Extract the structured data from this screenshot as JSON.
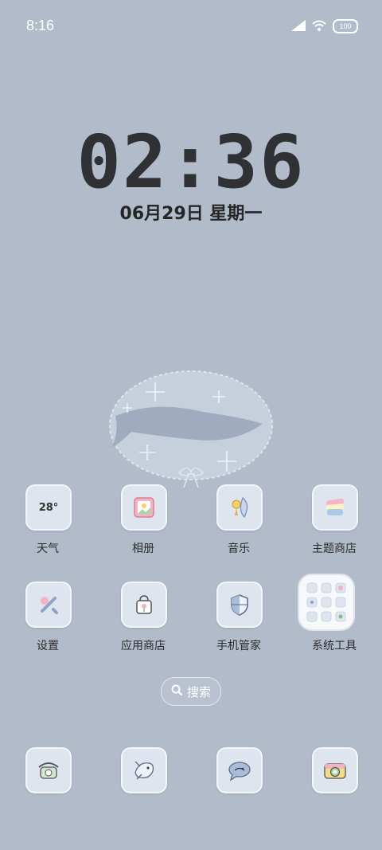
{
  "status_bar": {
    "time": "8:16",
    "battery": "100",
    "icons": [
      "signal-icon",
      "wifi-icon",
      "battery-icon"
    ]
  },
  "lock_widget": {
    "clock": "02:36",
    "date": "06月29日 星期一"
  },
  "apps_row1": [
    {
      "label": "天气",
      "icon": "weather-icon",
      "badge_text": "28°"
    },
    {
      "label": "相册",
      "icon": "gallery-icon"
    },
    {
      "label": "音乐",
      "icon": "music-icon"
    },
    {
      "label": "主题商店",
      "icon": "theme-store-icon"
    }
  ],
  "apps_row2": [
    {
      "label": "设置",
      "icon": "settings-icon"
    },
    {
      "label": "应用商店",
      "icon": "app-store-icon"
    },
    {
      "label": "手机管家",
      "icon": "security-icon"
    },
    {
      "label": "系统工具",
      "icon": "system-tools-folder-icon"
    }
  ],
  "search": {
    "label": "搜索",
    "icon": "search-icon"
  },
  "dock": [
    {
      "icon": "phone-icon"
    },
    {
      "icon": "messages-icon"
    },
    {
      "icon": "chat-bubble-icon"
    },
    {
      "icon": "camera-icon"
    }
  ],
  "colors": {
    "wallpaper": "#b2bbc9",
    "icon_bg": "#dfe5ee",
    "clock": "#2f3135"
  }
}
